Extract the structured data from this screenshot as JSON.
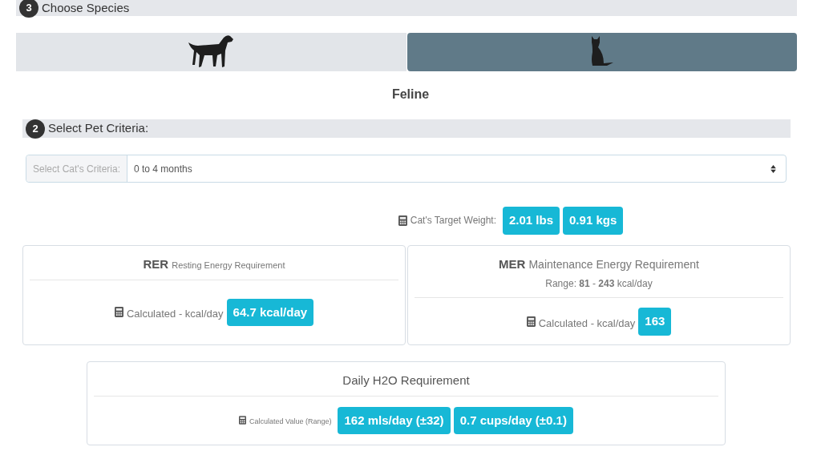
{
  "species_header": {
    "step": "3",
    "title": "Choose Species"
  },
  "species": [
    {
      "kind": "dog",
      "selected": false
    },
    {
      "kind": "cat",
      "selected": true
    }
  ],
  "species_name": "Feline",
  "criteria_header": {
    "step": "2",
    "title": "Select Pet Criteria:"
  },
  "criteria_select": {
    "label": "Select Cat's Criteria:",
    "value": "0 to 4 months"
  },
  "target_weight": {
    "label": "Cat's Target Weight:",
    "badges": [
      "2.01 lbs",
      "0.91 kgs"
    ]
  },
  "cards": [
    {
      "abbr": "RER",
      "title": "Resting Energy Requirement",
      "label": "Calculated - kcal/day",
      "badges": [
        "64.7 kcal/day"
      ]
    },
    {
      "abbr": "MER",
      "title": "Maintenance Energy Requirement",
      "range": "Range: **81** - **243** kcal/day",
      "label": "Calculated - kcal/day",
      "badges": [
        "163"
      ]
    }
  ],
  "water_card": {
    "title": "Daily H2O Requirement",
    "label": "Calculated Value (Range)",
    "badges": [
      "162 mls/day (±32)",
      "0.7 cups/day (±0.1)"
    ]
  }
}
